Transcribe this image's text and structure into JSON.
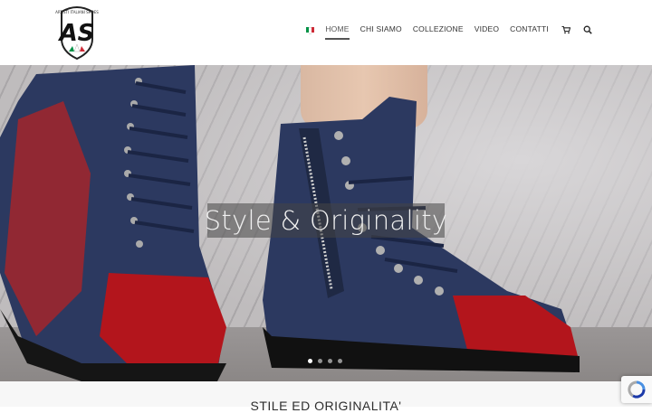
{
  "brand": {
    "logo_letters": "AS",
    "logo_arc_text": "ARTISTI ITALIANI SHOES"
  },
  "nav": {
    "language_flag_colors": [
      "#009246",
      "#ffffff",
      "#ce2b37"
    ],
    "items": [
      {
        "label": "HOME",
        "active": true
      },
      {
        "label": "CHI SIAMO",
        "active": false
      },
      {
        "label": "COLLEZIONE",
        "active": false
      },
      {
        "label": "VIDEO",
        "active": false
      },
      {
        "label": "CONTATTI",
        "active": false
      }
    ],
    "cart_icon": "cart-icon",
    "search_icon": "search-icon"
  },
  "hero": {
    "caption": "Style & Originality",
    "slides_total": 4,
    "active_slide": 1
  },
  "section": {
    "title": "STILE ED ORIGINALITA'"
  },
  "colors": {
    "nav_text": "#333333",
    "caption_bg": "#464646",
    "boot_navy": "#2c3960",
    "boot_red": "#b3151c"
  }
}
